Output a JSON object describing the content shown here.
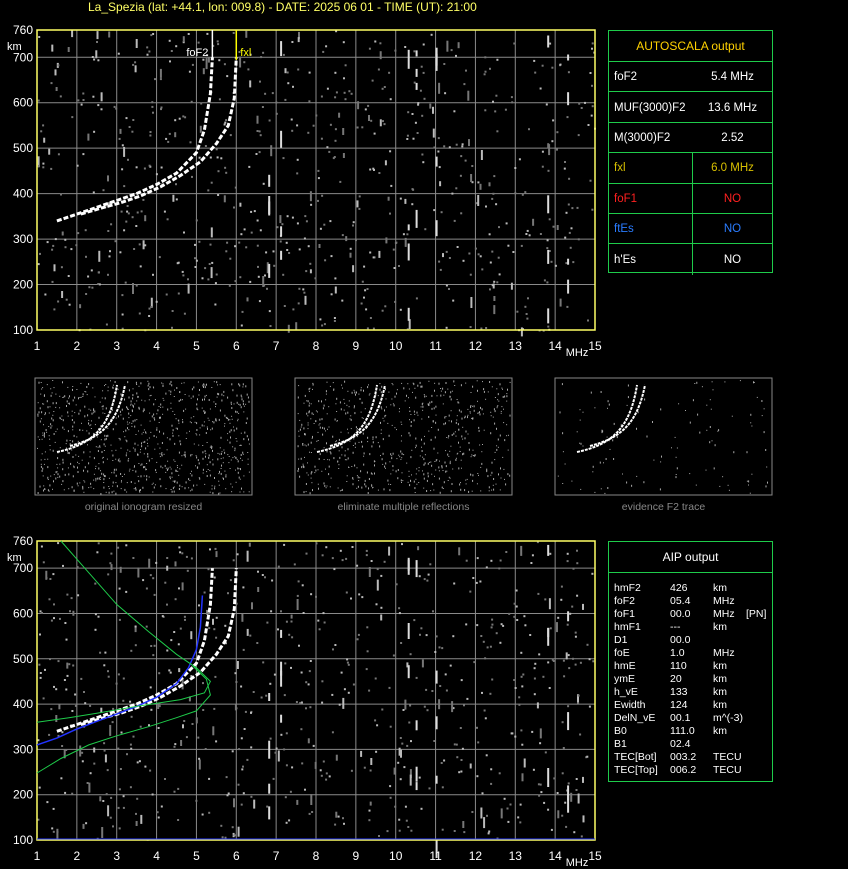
{
  "title": "La_Spezia (lat: +44.1, lon: 009.8) - DATE: 2025 06 01 - TIME (UT): 21:00",
  "colors": {
    "grid": "#8a8a8a",
    "axis_frame": "#ffff66",
    "trace": "#ffffff",
    "green": "#1ecb4a",
    "blue_profile": "#2233ff",
    "panel_border": "#888888",
    "fxl_marker": "#ffff00",
    "fof2_marker": "#ffffff"
  },
  "chart_data": [
    {
      "type": "scatter",
      "title": "",
      "xlabel": "MHz",
      "ylabel": "km",
      "xlim": [
        1,
        15
      ],
      "ylim": [
        100,
        760
      ],
      "x_ticks": [
        "1",
        "2",
        "3",
        "4",
        "5",
        "6",
        "7",
        "8",
        "9",
        "10",
        "11",
        "12",
        "13",
        "14",
        "15"
      ],
      "y_ticks": [
        "100",
        "200",
        "300",
        "400",
        "500",
        "600",
        "700",
        "760"
      ],
      "grid": true,
      "annotations": [
        {
          "label": "foF2",
          "x": 5.4
        },
        {
          "label": "fxl",
          "x": 6.0
        }
      ],
      "series": [
        {
          "kind": "o-trace",
          "x": [
            1.5,
            2.0,
            2.5,
            3.0,
            3.5,
            4.0,
            4.5,
            5.0,
            5.2,
            5.35,
            5.4
          ],
          "y": [
            340,
            355,
            370,
            385,
            400,
            420,
            445,
            490,
            540,
            620,
            700
          ]
        },
        {
          "kind": "x-trace",
          "x": [
            2.1,
            2.6,
            3.1,
            3.6,
            4.1,
            4.6,
            5.1,
            5.5,
            5.8,
            5.95,
            6.0
          ],
          "y": [
            355,
            368,
            380,
            395,
            415,
            440,
            470,
            510,
            550,
            610,
            700
          ]
        }
      ]
    },
    {
      "type": "line",
      "title": "",
      "xlabel": "MHz",
      "ylabel": "km",
      "xlim": [
        1,
        15
      ],
      "ylim": [
        100,
        760
      ],
      "x_ticks": [
        "1",
        "2",
        "3",
        "4",
        "5",
        "6",
        "7",
        "8",
        "9",
        "10",
        "11",
        "12",
        "13",
        "14",
        "15"
      ],
      "y_ticks": [
        "100",
        "200",
        "300",
        "400",
        "500",
        "600",
        "700",
        "760"
      ],
      "grid": true,
      "series": [
        {
          "kind": "o-trace",
          "x": [
            1.5,
            2.0,
            2.5,
            3.0,
            3.5,
            4.0,
            4.5,
            5.0,
            5.2,
            5.35,
            5.4
          ],
          "y": [
            340,
            355,
            370,
            385,
            400,
            420,
            445,
            490,
            540,
            620,
            700
          ]
        },
        {
          "kind": "x-trace",
          "x": [
            2.1,
            2.6,
            3.1,
            3.6,
            4.1,
            4.6,
            5.1,
            5.5,
            5.8,
            5.95,
            6.0
          ],
          "y": [
            355,
            368,
            380,
            395,
            415,
            440,
            470,
            510,
            550,
            610,
            700
          ]
        },
        {
          "kind": "blue-fit",
          "x": [
            1.0,
            1.5,
            2.0,
            2.5,
            3.0,
            3.5,
            4.0,
            4.5,
            4.8,
            5.0,
            5.1,
            5.15
          ],
          "y": [
            310,
            325,
            345,
            362,
            378,
            395,
            415,
            445,
            480,
            520,
            570,
            640
          ]
        },
        {
          "kind": "green-upper",
          "x": [
            1.6,
            2.2,
            3.0,
            3.8,
            4.5,
            5.0,
            5.35,
            5.2,
            4.6,
            3.5,
            2.5,
            1.8,
            1.0
          ],
          "y": [
            760,
            700,
            620,
            560,
            510,
            480,
            450,
            425,
            410,
            395,
            380,
            370,
            360
          ]
        },
        {
          "kind": "green-lower",
          "x": [
            1.0,
            1.6,
            2.3,
            3.0,
            3.8,
            4.5,
            5.0,
            5.35,
            5.25,
            4.9
          ],
          "y": [
            248,
            280,
            310,
            330,
            350,
            370,
            385,
            420,
            455,
            485
          ]
        }
      ]
    }
  ],
  "autoscala": {
    "title": "AUTOSCALA output",
    "rows": [
      {
        "label": "foF2",
        "value": "5.4 MHz",
        "lc": "#ffffff",
        "vc": "#ffffff"
      },
      {
        "label": "MUF(3000)F2",
        "value": "13.6 MHz",
        "lc": "#ffffff",
        "vc": "#ffffff"
      },
      {
        "label": "M(3000)F2",
        "value": "2.52",
        "lc": "#ffffff",
        "vc": "#ffffff"
      },
      {
        "label": "fxl",
        "value": "6.0 MHz",
        "lc": "#d8c000",
        "vc": "#d8c000"
      },
      {
        "label": "foF1",
        "value": "NO",
        "lc": "#ff2020",
        "vc": "#ff2020"
      },
      {
        "label": "ftEs",
        "value": "NO",
        "lc": "#2a7cff",
        "vc": "#2a7cff"
      },
      {
        "label": "h'Es",
        "value": "NO",
        "lc": "#ffffff",
        "vc": "#ffffff"
      }
    ]
  },
  "thumbnails": [
    {
      "caption": "original ionogram resized"
    },
    {
      "caption": "eliminate multiple reflections"
    },
    {
      "caption": "evidence F2 trace"
    }
  ],
  "aip": {
    "title": "AIP output",
    "rows": [
      [
        "hmF2",
        "426",
        "km",
        ""
      ],
      [
        "foF2",
        "05.4",
        "MHz",
        ""
      ],
      [
        "foF1",
        "00.0",
        "MHz",
        "[PN]"
      ],
      [
        "hmF1",
        "---",
        "km",
        ""
      ],
      [
        "D1",
        "00.0",
        "",
        ""
      ],
      [
        "foE",
        "1.0",
        "MHz",
        ""
      ],
      [
        "hmE",
        "110",
        "km",
        ""
      ],
      [
        "ymE",
        "20",
        "km",
        ""
      ],
      [
        "h_vE",
        "133",
        "km",
        ""
      ],
      [
        "Ewidth",
        "124",
        "km",
        ""
      ],
      [
        "DelN_vE",
        "00.1",
        "m^(-3)",
        ""
      ],
      [
        "B0",
        "111.0",
        "km",
        ""
      ],
      [
        "B1",
        "02.4",
        "",
        ""
      ],
      [
        "TEC[Bot]",
        "003.2",
        "TECU",
        ""
      ],
      [
        "TEC[Top]",
        "006.2",
        "TECU",
        ""
      ]
    ]
  }
}
